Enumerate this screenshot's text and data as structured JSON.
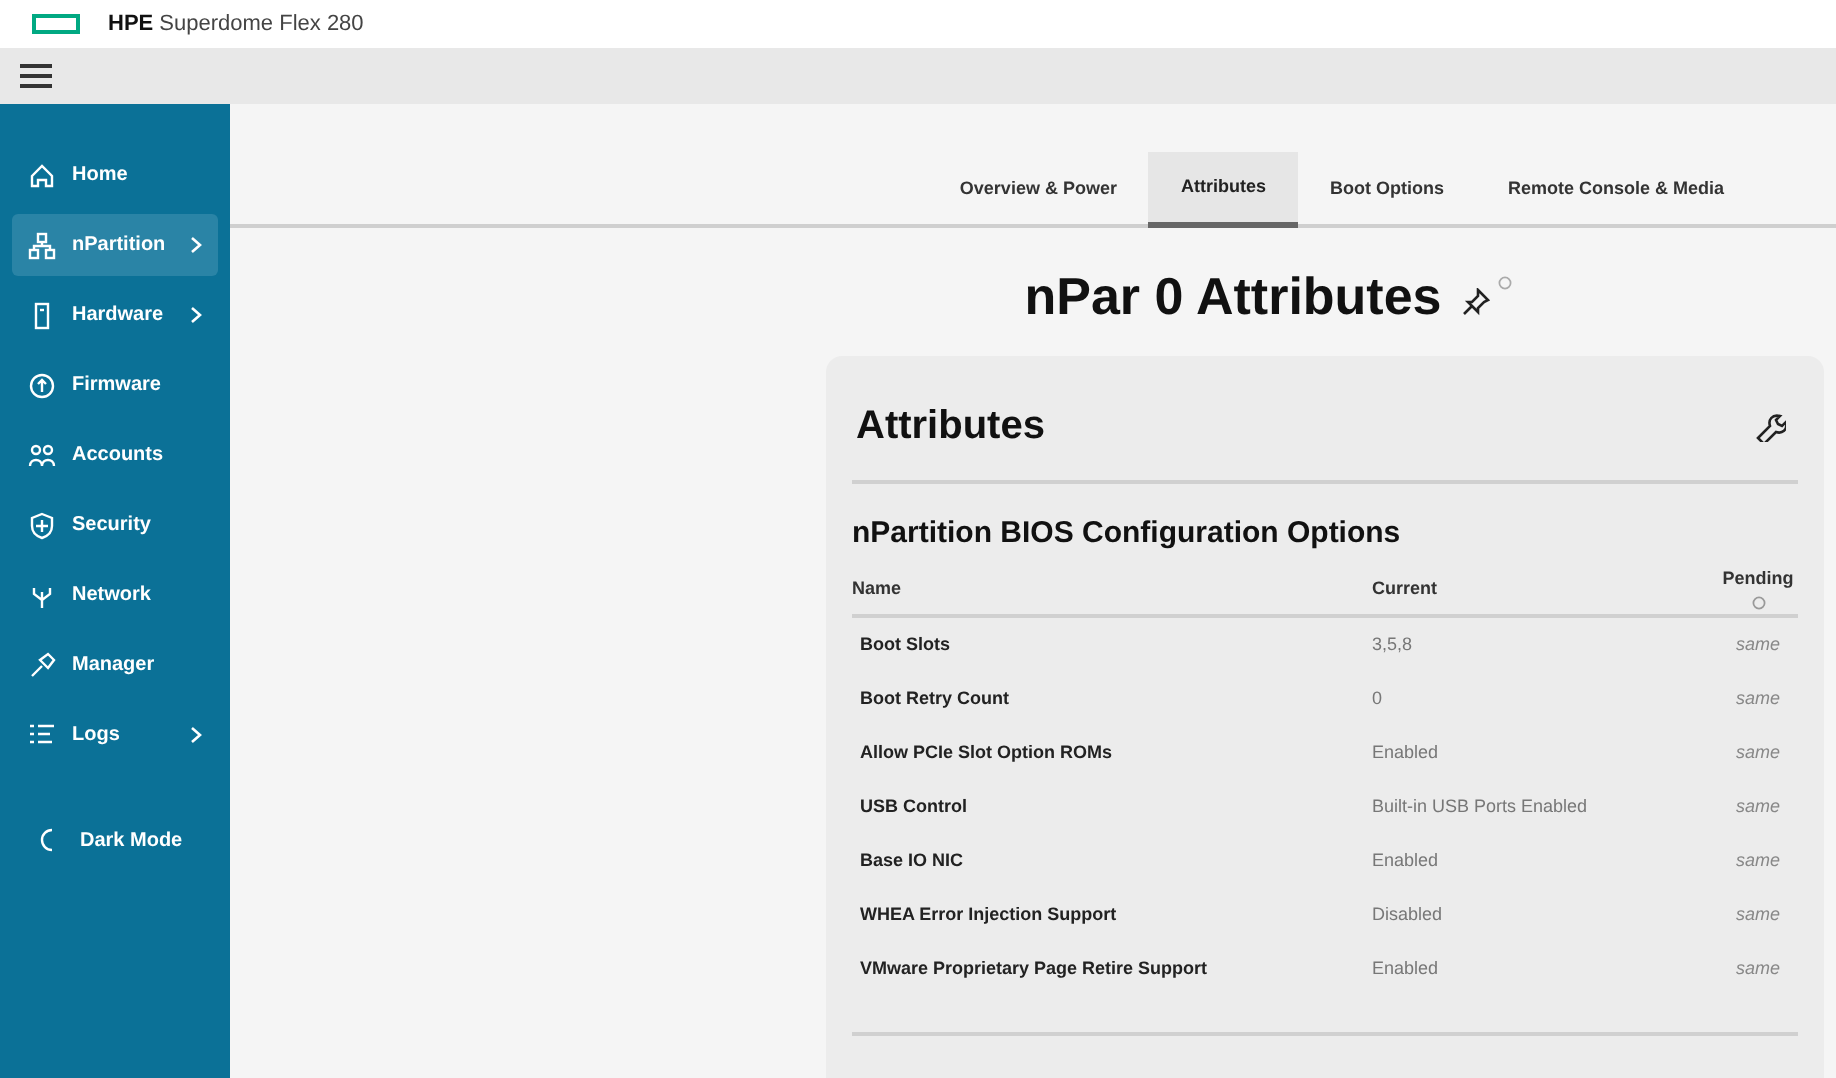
{
  "header": {
    "brand": "HPE",
    "product": "Superdome Flex 280"
  },
  "sidebar": {
    "items": [
      {
        "label": "Home",
        "selected": false,
        "submenu": false
      },
      {
        "label": "nPartition",
        "selected": true,
        "submenu": true
      },
      {
        "label": "Hardware",
        "selected": false,
        "submenu": true
      },
      {
        "label": "Firmware",
        "selected": false,
        "submenu": false
      },
      {
        "label": "Accounts",
        "selected": false,
        "submenu": false
      },
      {
        "label": "Security",
        "selected": false,
        "submenu": false
      },
      {
        "label": "Network",
        "selected": false,
        "submenu": false
      },
      {
        "label": "Manager",
        "selected": false,
        "submenu": false
      },
      {
        "label": "Logs",
        "selected": false,
        "submenu": true
      }
    ],
    "dark_mode": "Dark Mode"
  },
  "tabs": [
    {
      "label": "Overview & Power",
      "selected": false
    },
    {
      "label": "Attributes",
      "selected": true
    },
    {
      "label": "Boot Options",
      "selected": false
    },
    {
      "label": "Remote Console & Media",
      "selected": false
    }
  ],
  "page_title": "nPar 0 Attributes",
  "card": {
    "title": "Attributes",
    "section": "nPartition BIOS Configuration Options",
    "columns": [
      "Name",
      "Current",
      "Pending"
    ],
    "rows": [
      {
        "name": "Boot Slots",
        "current": "3,5,8",
        "pending": "same"
      },
      {
        "name": "Boot Retry Count",
        "current": "0",
        "pending": "same"
      },
      {
        "name": "Allow PCIe Slot Option ROMs",
        "current": "Enabled",
        "pending": "same"
      },
      {
        "name": "USB Control",
        "current": "Built-in USB Ports Enabled",
        "pending": "same"
      },
      {
        "name": "Base IO NIC",
        "current": "Enabled",
        "pending": "same"
      },
      {
        "name": "WHEA Error Injection Support",
        "current": "Disabled",
        "pending": "same"
      },
      {
        "name": "VMware Proprietary Page Retire Support",
        "current": "Enabled",
        "pending": "same"
      }
    ]
  }
}
